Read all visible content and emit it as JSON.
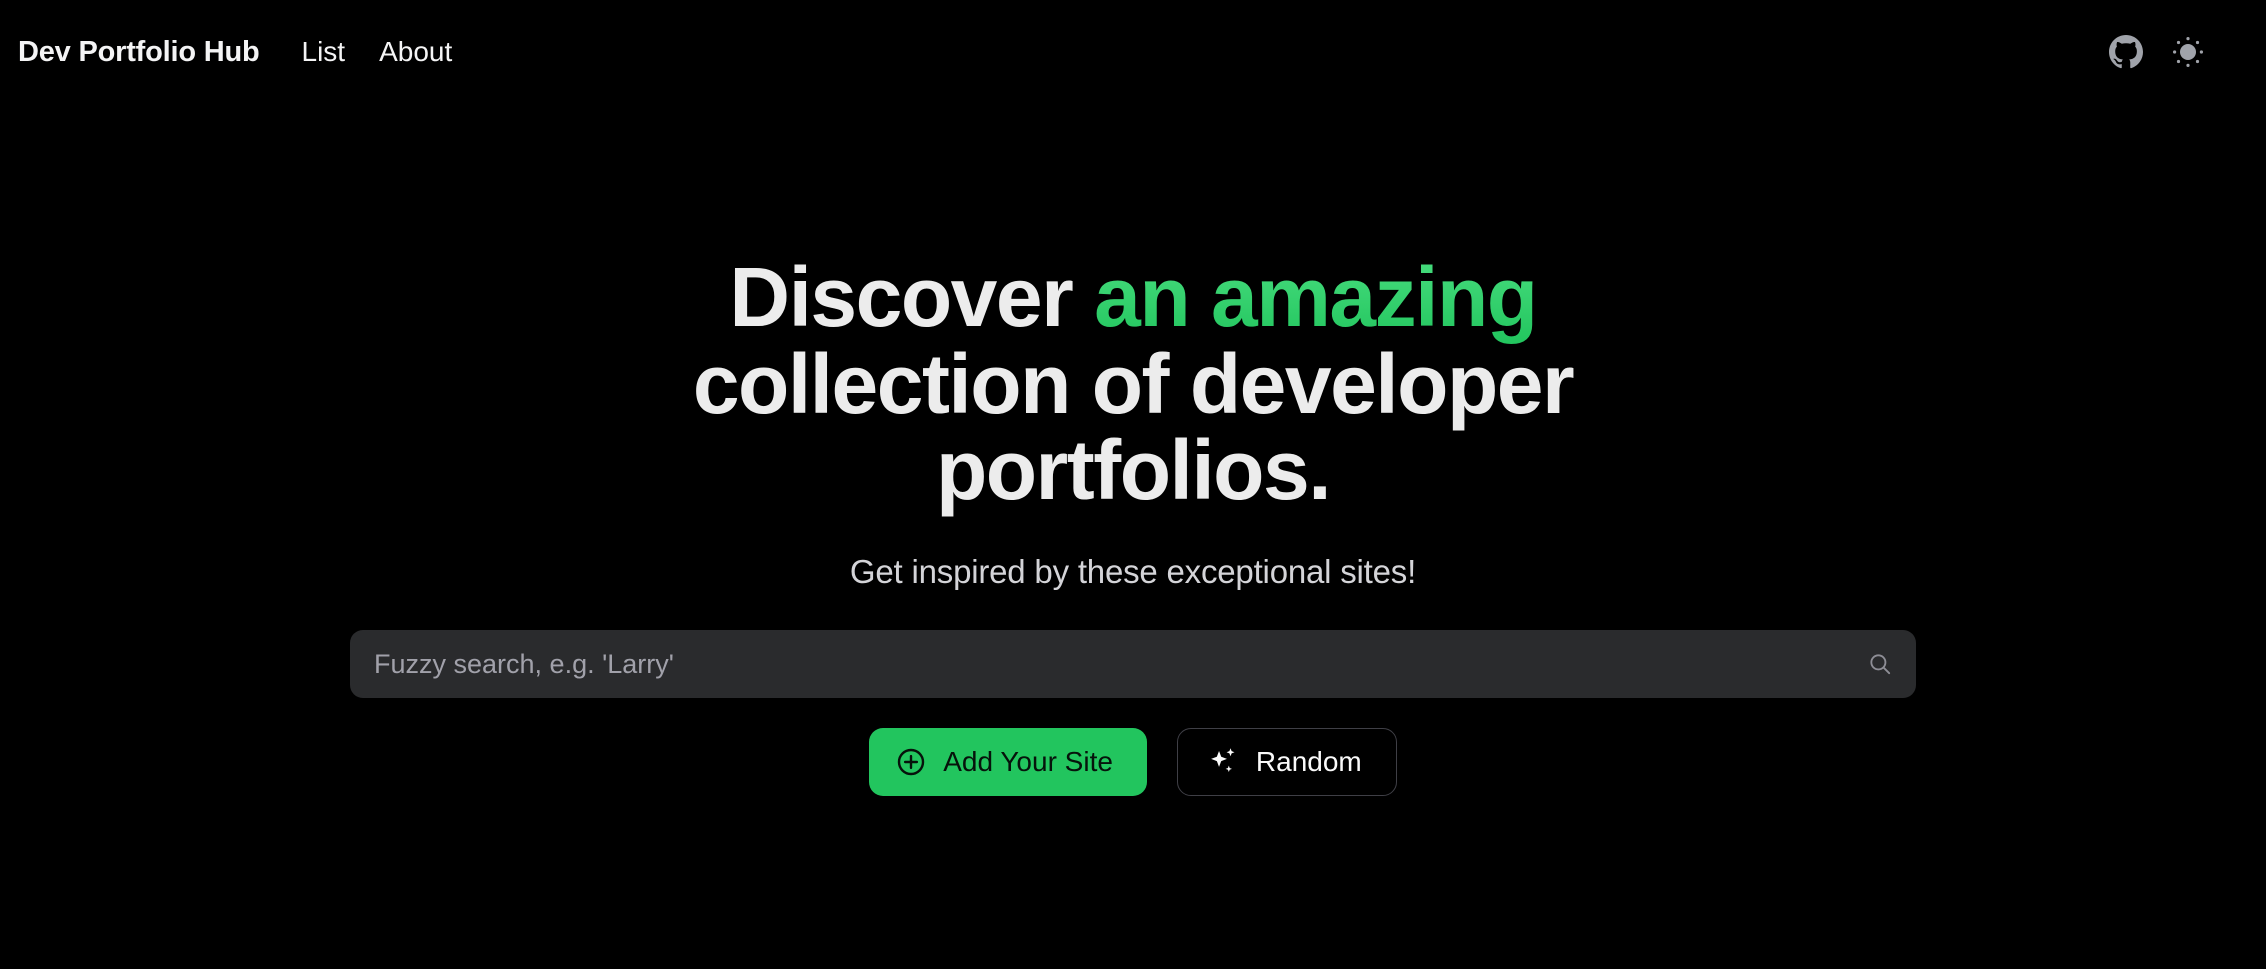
{
  "nav": {
    "brand": "Dev Portfolio Hub",
    "links": [
      {
        "label": "List"
      },
      {
        "label": "About"
      }
    ],
    "github_icon": "github-icon",
    "theme_toggle_icon": "sun-icon"
  },
  "hero": {
    "headline_part1": "Discover ",
    "headline_accent": "an amazing",
    "headline_part2": " collection of developer portfolios.",
    "subtitle": "Get inspired by these exceptional sites!"
  },
  "search": {
    "value": "",
    "placeholder": "Fuzzy search, e.g. 'Larry'",
    "icon": "search-icon"
  },
  "actions": {
    "primary": {
      "label": "Add Your Site",
      "icon": "plus-circle-icon"
    },
    "secondary": {
      "label": "Random",
      "icon": "sparkles-icon"
    }
  },
  "colors": {
    "background": "#000000",
    "accent_green": "#22c55e",
    "accent_green_light": "#4ade80",
    "text_primary": "#ececec",
    "text_secondary": "#d4d4d8",
    "input_background": "#2a2b2d",
    "border": "#3f3f46",
    "icon_gray": "#a0a3aa"
  }
}
